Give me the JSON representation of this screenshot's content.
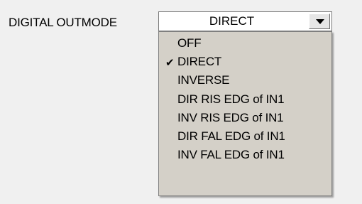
{
  "field_label": "DIGITAL OUTMODE",
  "combo": {
    "value": "DIRECT",
    "arrow_icon": "chevron-down-icon"
  },
  "dropdown": {
    "checkmark": "✔",
    "options": [
      {
        "label": "OFF",
        "checked": false
      },
      {
        "label": "DIRECT",
        "checked": true
      },
      {
        "label": "INVERSE",
        "checked": false
      },
      {
        "label": "DIR RIS EDG of IN1",
        "checked": false
      },
      {
        "label": "INV RIS EDG of IN1",
        "checked": false
      },
      {
        "label": "DIR FAL EDG of IN1",
        "checked": false
      },
      {
        "label": "INV FAL EDG of IN1",
        "checked": false
      }
    ]
  },
  "colors": {
    "background": "#f0f0f0",
    "dropdown_bg": "#d4d0c8"
  }
}
